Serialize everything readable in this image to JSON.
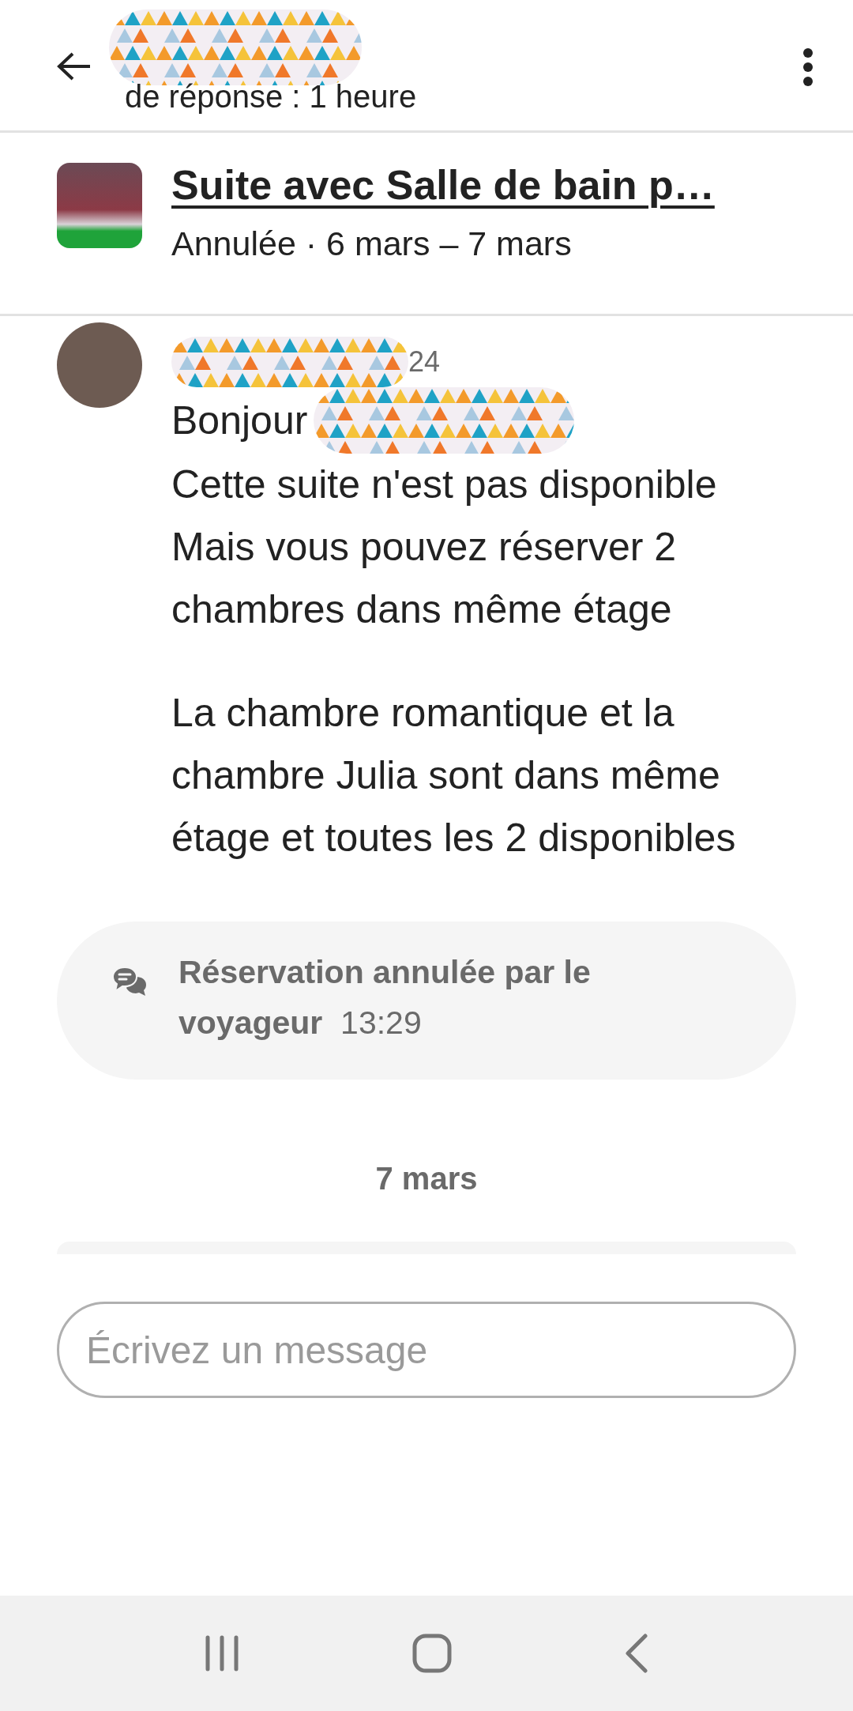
{
  "header": {
    "subtitle": "de réponse : 1 heure"
  },
  "listing": {
    "title": "Suite avec Salle de bain p…",
    "status": "Annulée · 6 mars – 7 mars"
  },
  "message": {
    "time": "24",
    "greeting": "Bonjour",
    "paragraphs": [
      [
        "Cette suite n'est pas disponible",
        "Mais vous pouvez réserver 2 chambres dans même étage"
      ],
      [
        "La chambre romantique et la chambre Julia sont dans même étage et toutes les 2 disponibles"
      ]
    ]
  },
  "event": {
    "text": "Réservation annulée par le voyageur",
    "time": "13:29"
  },
  "date_divider": "7 mars",
  "composer": {
    "placeholder": "Écrivez un message"
  }
}
